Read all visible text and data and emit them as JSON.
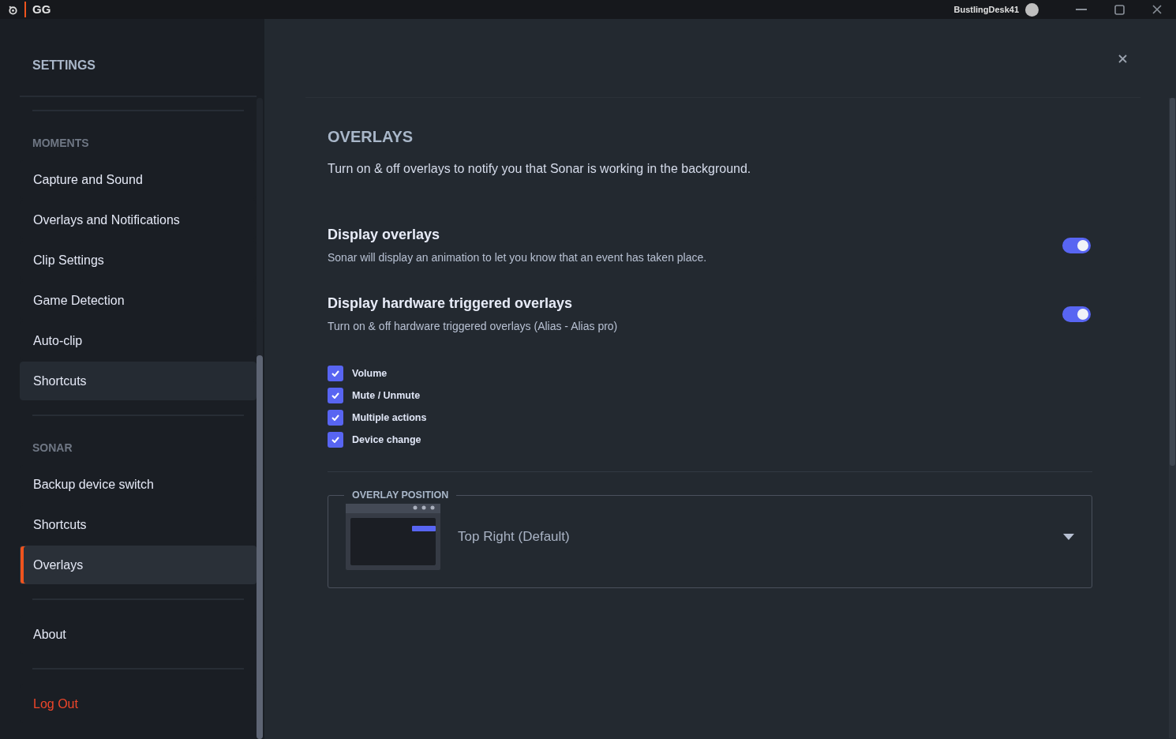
{
  "titlebar": {
    "app_name": "GG",
    "username": "BustlingDesk41"
  },
  "sidebar": {
    "title": "SETTINGS",
    "sections": [
      {
        "label": "MOMENTS",
        "items": [
          {
            "label": "Capture and Sound",
            "selected": false,
            "highlighted": false,
            "kind": "link"
          },
          {
            "label": "Overlays and Notifications",
            "selected": false,
            "highlighted": false,
            "kind": "link"
          },
          {
            "label": "Clip Settings",
            "selected": false,
            "highlighted": false,
            "kind": "link"
          },
          {
            "label": "Game Detection",
            "selected": false,
            "highlighted": false,
            "kind": "link"
          },
          {
            "label": "Auto-clip",
            "selected": false,
            "highlighted": false,
            "kind": "link"
          },
          {
            "label": "Shortcuts",
            "selected": false,
            "highlighted": true,
            "kind": "link"
          }
        ]
      },
      {
        "label": "SONAR",
        "items": [
          {
            "label": "Backup device switch",
            "selected": false,
            "highlighted": false,
            "kind": "link"
          },
          {
            "label": "Shortcuts",
            "selected": false,
            "highlighted": false,
            "kind": "link"
          },
          {
            "label": "Overlays",
            "selected": true,
            "highlighted": false,
            "kind": "link"
          }
        ]
      },
      {
        "items": [
          {
            "label": "About",
            "selected": false,
            "highlighted": false,
            "kind": "link"
          }
        ]
      },
      {
        "items": [
          {
            "label": "Log Out",
            "selected": false,
            "highlighted": false,
            "kind": "danger"
          }
        ]
      }
    ]
  },
  "main": {
    "title": "OVERLAYS",
    "description": "Turn on & off overlays to notify you that Sonar is working in the background.",
    "settings": [
      {
        "title": "Display overlays",
        "description": "Sonar will display an animation to let you know that an event has taken place.",
        "on": true
      },
      {
        "title": "Display hardware triggered overlays",
        "description": "Turn on & off hardware triggered overlays (Alias - Alias pro)",
        "on": true
      }
    ],
    "options": [
      {
        "label": "Volume",
        "checked": true
      },
      {
        "label": "Mute / Unmute",
        "checked": true
      },
      {
        "label": "Multiple actions",
        "checked": true
      },
      {
        "label": "Device change",
        "checked": true
      }
    ],
    "overlay_position": {
      "legend": "OVERLAY POSITION",
      "value": "Top Right (Default)"
    }
  }
}
